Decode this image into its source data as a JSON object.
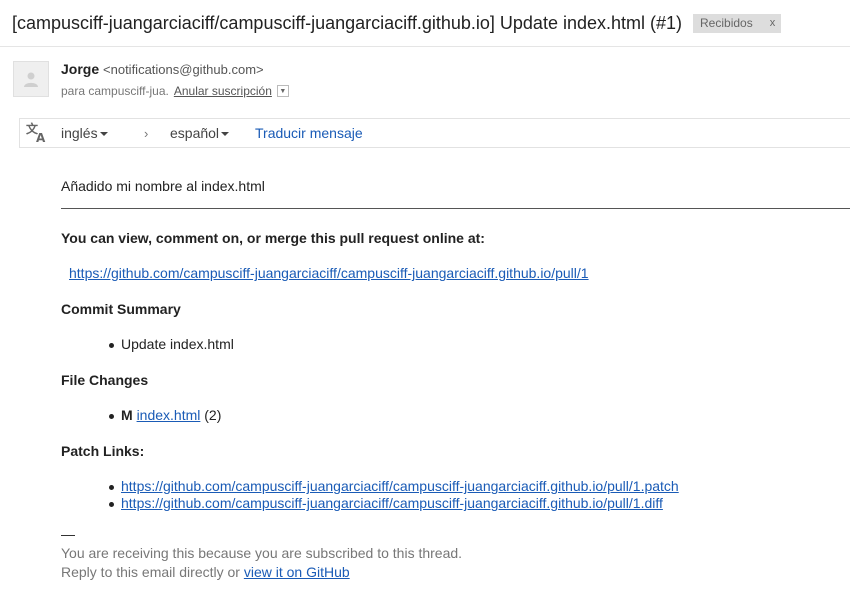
{
  "subject": {
    "title": "[campusciff-juangarciaciff/campusciff-juangarciaciff.github.io] Update index.html (#1)",
    "label": "Recibidos",
    "label_close": "x"
  },
  "sender": {
    "name": "Jorge",
    "address": "<notifications@github.com>",
    "recipient": "para campusciff-jua.",
    "unsubscribe": "Anular suscripción"
  },
  "translate": {
    "from_lang": "inglés",
    "arrow": "›",
    "to_lang": "español",
    "action": "Traducir mensaje"
  },
  "message": {
    "intro": "Añadido mi nombre al index.html",
    "view_heading": "You can view, comment on, or merge this pull request online at:",
    "pr_link": "https://github.com/campusciff-juangarciaciff/campusciff-juangarciaciff.github.io/pull/1",
    "commit_heading": "Commit Summary",
    "commits": [
      "Update index.html"
    ],
    "files_heading": "File Changes",
    "file_change": {
      "status": "M",
      "file": "index.html",
      "count": "(2)"
    },
    "patch_heading": "Patch Links:",
    "patch_links": [
      "https://github.com/campusciff-juangarciaciff/campusciff-juangarciaciff.github.io/pull/1.patch",
      "https://github.com/campusciff-juangarciaciff/campusciff-juangarciaciff.github.io/pull/1.diff"
    ],
    "signature_dash": "—",
    "footer_line1": "You are receiving this because you are subscribed to this thread.",
    "footer_line2_prefix": "Reply to this email directly or",
    "footer_link": "view it on GitHub"
  },
  "colors": {
    "link": "#1a5bb6",
    "chip_bg": "#dddddd"
  }
}
